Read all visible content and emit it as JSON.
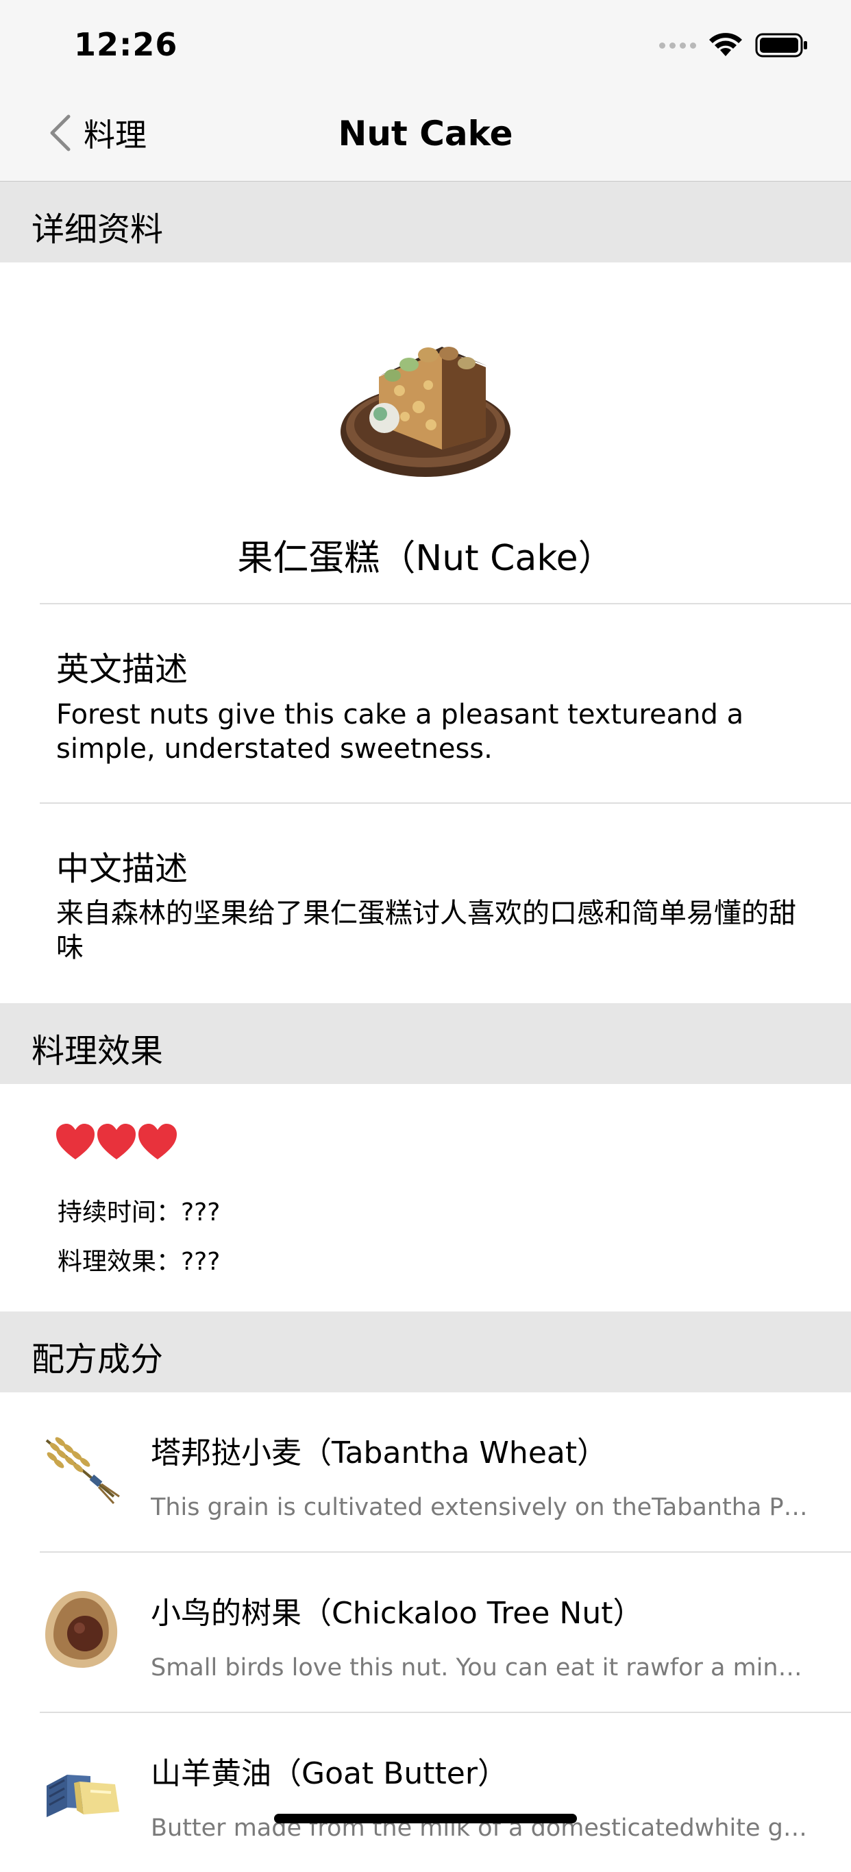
{
  "status_bar": {
    "time": "12:26"
  },
  "nav": {
    "back_label": "料理",
    "title": "Nut Cake"
  },
  "sections": {
    "details": "详细资料",
    "effects": "料理效果",
    "ingredients": "配方成分"
  },
  "dish": {
    "name": "果仁蛋糕（Nut Cake）",
    "english_heading": "英文描述",
    "english_text": "Forest nuts give this cake a pleasant textureand a simple, understated sweetness.",
    "chinese_heading": "中文描述",
    "chinese_text": "来自森林的坚果给了果仁蛋糕讨人喜欢的口感和简单易懂的甜味"
  },
  "effects": {
    "hearts": 3,
    "heart_color": "#e8323c",
    "duration": "持续时间：???",
    "effect": "料理效果：???"
  },
  "ingredients": [
    {
      "title": "塔邦挞小麦（Tabantha Wheat）",
      "desc": "This grain is cultivated extensively on theTabantha Plains and is a common ingredient",
      "icon": "wheat-icon"
    },
    {
      "title": "小鸟的树果（Chickaloo Tree Nut）",
      "desc": "Small birds love this nut. You can eat it rawfor a minor boost to health",
      "icon": "tree-nut-icon"
    },
    {
      "title": "山羊黄油（Goat Butter）",
      "desc": "Butter made from the milk of a domesticatedwhite goat, used in many dishes",
      "icon": "butter-icon"
    }
  ]
}
